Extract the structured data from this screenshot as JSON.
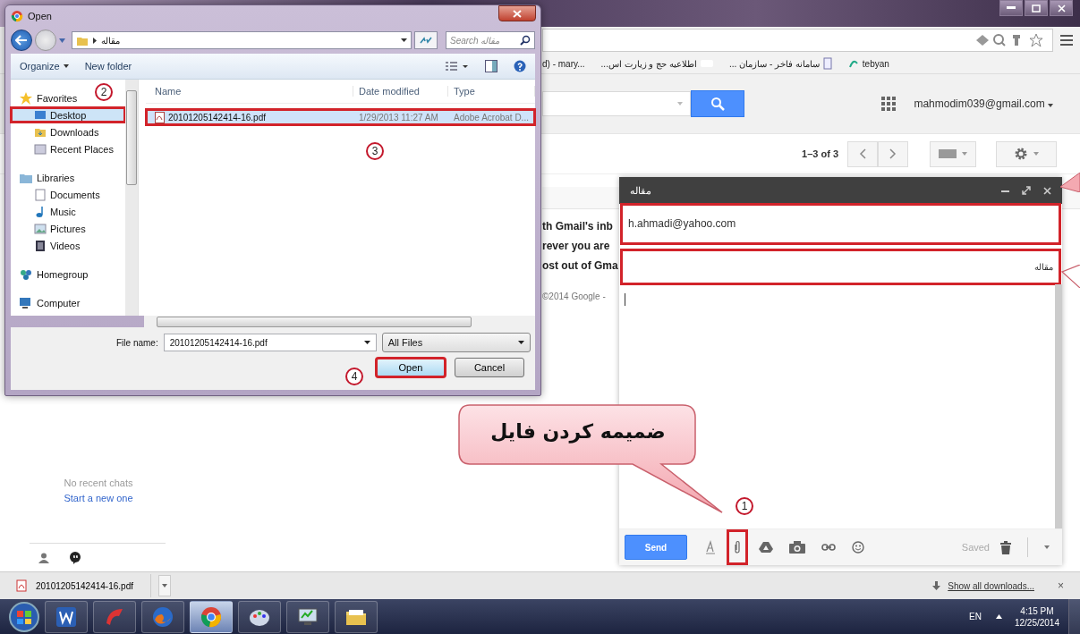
{
  "browser": {
    "bookmarks": [
      {
        "label": "d) - mary..."
      },
      {
        "label": "اطلاعیه حج و زیارت اس..."
      },
      {
        "label": "سامانه فاخر - سازمان ..."
      },
      {
        "label": "tebyan"
      }
    ],
    "account": "mahmodim039@gmail.com",
    "pagination": "1–3 of 3",
    "snippets": [
      "th Gmail's inb",
      "rever you are",
      "ost out of Gma"
    ],
    "footer": "©2014 Google -",
    "chat": {
      "empty": "No recent chats",
      "link": "Start a new one"
    }
  },
  "dialog": {
    "title": "Open",
    "path": "مقاله",
    "search_placeholder": "Search مقاله",
    "toolbar": [
      "Organize",
      "New folder"
    ],
    "nav": [
      {
        "label": "Favorites",
        "selected": false,
        "children": [
          {
            "label": "Desktop",
            "selected": true
          },
          {
            "label": "Downloads",
            "selected": false
          },
          {
            "label": "Recent Places",
            "selected": false
          }
        ]
      },
      {
        "label": "Libraries",
        "selected": false,
        "children": [
          {
            "label": "Documents",
            "selected": false
          },
          {
            "label": "Music",
            "selected": false
          },
          {
            "label": "Pictures",
            "selected": false
          },
          {
            "label": "Videos",
            "selected": false
          }
        ]
      },
      {
        "label": "Homegroup",
        "selected": false
      },
      {
        "label": "Computer",
        "selected": false
      }
    ],
    "columns": [
      "Name",
      "Date modified",
      "Type"
    ],
    "files": [
      {
        "name": "20101205142414-16.pdf",
        "date": "1/29/2013 11:27 AM",
        "type": "Adobe Acrobat D...",
        "selected": true
      }
    ],
    "file_name_label": "File name:",
    "file_name": "20101205142414-16.pdf",
    "filter": "All Files",
    "buttons": [
      "Open",
      "Cancel"
    ]
  },
  "compose": {
    "title": "مقاله",
    "to": "h.ahmadi@yahoo.com",
    "subject": "مقاله",
    "send": "Send",
    "status": "Saved"
  },
  "downloads": {
    "file": "20101205142414-16.pdf",
    "show_all": "Show all downloads...",
    "close": "×"
  },
  "taskbar": {
    "language": "EN",
    "time": "4:15 PM",
    "date": "12/25/2014"
  },
  "annotations": {
    "callout": "ضمیمه کردن فایل",
    "markers": [
      "1",
      "2",
      "3",
      "4"
    ]
  }
}
